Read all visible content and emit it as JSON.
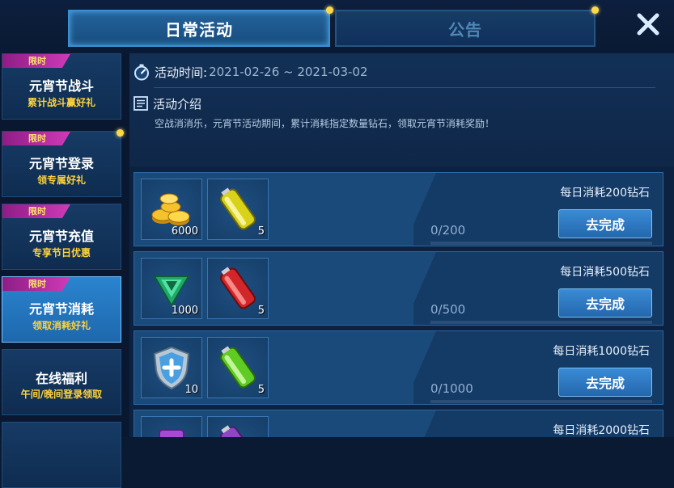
{
  "tabs": [
    {
      "label": "日常活动",
      "active": true,
      "has_dot": true
    },
    {
      "label": "公告",
      "active": false,
      "has_dot": true
    }
  ],
  "close_icon": "close-icon",
  "sidebar": {
    "items": [
      {
        "badge": "限时",
        "title": "元宵节战斗",
        "subtitle": "累计战斗赢好礼",
        "active": false,
        "has_dot": false
      },
      {
        "badge": "限时",
        "title": "元宵节登录",
        "subtitle": "领专属好礼",
        "active": false,
        "has_dot": true
      },
      {
        "badge": "限时",
        "title": "元宵节充值",
        "subtitle": "专享节日优惠",
        "active": false,
        "has_dot": false
      },
      {
        "badge": "限时",
        "title": "元宵节消耗",
        "subtitle": "领取消耗好礼",
        "active": true,
        "has_dot": false
      },
      {
        "badge": "",
        "title": "在线福利",
        "subtitle": "午间/晚间登录领取",
        "active": false,
        "has_dot": false
      }
    ]
  },
  "info": {
    "time_label": "活动时间:",
    "time_value": "2021-02-26 ~ 2021-03-02",
    "intro_label": "活动介绍",
    "description": "空战消消乐，元宵节活动期间，累计消耗指定数量钻石，领取元宵节消耗奖励！"
  },
  "tasks": [
    {
      "requirement": "每日消耗200钻石",
      "progress": "0/200",
      "progress_fraction": 0,
      "button": "去完成",
      "rewards": [
        {
          "icon": "gold-coins-icon",
          "qty": "6000"
        },
        {
          "icon": "yellow-battery-icon",
          "qty": "5"
        }
      ]
    },
    {
      "requirement": "每日消耗500钻石",
      "progress": "0/500",
      "progress_fraction": 0,
      "button": "去完成",
      "rewards": [
        {
          "icon": "green-gem-icon",
          "qty": "1000"
        },
        {
          "icon": "red-battery-icon",
          "qty": "5"
        }
      ]
    },
    {
      "requirement": "每日消耗1000钻石",
      "progress": "0/1000",
      "progress_fraction": 0,
      "button": "去完成",
      "rewards": [
        {
          "icon": "shield-icon",
          "qty": "10"
        },
        {
          "icon": "green-battery-icon",
          "qty": "5"
        }
      ]
    },
    {
      "requirement": "每日消耗2000钻石",
      "progress": "",
      "progress_fraction": 0,
      "button": "",
      "rewards": [
        {
          "icon": "purple-item-icon",
          "qty": ""
        },
        {
          "icon": "purple-battery-icon",
          "qty": ""
        }
      ]
    }
  ],
  "colors": {
    "accent": "#2a84cf",
    "badge": "#d03ab8",
    "gold_text": "#ffd23c",
    "dot": "#ffd84a"
  }
}
